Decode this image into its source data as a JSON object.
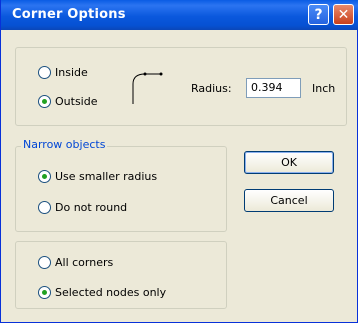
{
  "window": {
    "title": "Corner Options",
    "help_label": "?",
    "close_label": "✕"
  },
  "corner_type": {
    "options": [
      {
        "label": "Inside",
        "selected": false
      },
      {
        "label": "Outside",
        "selected": true
      }
    ],
    "radius_label": "Radius:",
    "radius_value": "0.394",
    "unit_label": "Inch"
  },
  "narrow_objects": {
    "title": "Narrow objects",
    "options": [
      {
        "label": "Use smaller radius",
        "selected": true
      },
      {
        "label": "Do not round",
        "selected": false
      }
    ]
  },
  "scope": {
    "options": [
      {
        "label": "All corners",
        "selected": false
      },
      {
        "label": "Selected nodes only",
        "selected": true
      }
    ]
  },
  "buttons": {
    "ok_label": "OK",
    "cancel_label": "Cancel"
  },
  "icons": {
    "corner_preview": "corner-shape-icon"
  }
}
